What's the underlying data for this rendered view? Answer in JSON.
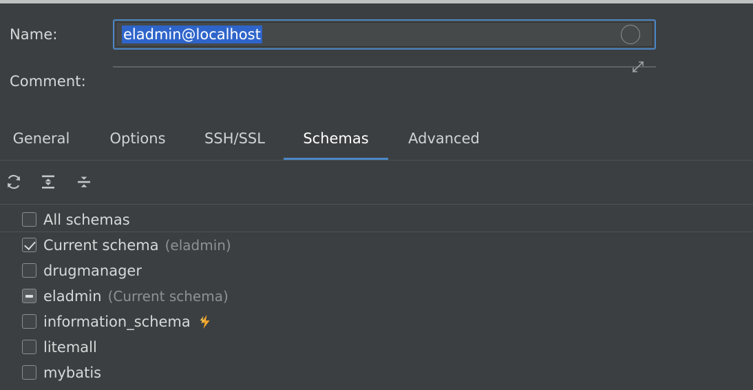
{
  "window": {
    "background_color": "#3c3f41",
    "accent_color": "#4b87c7"
  },
  "form": {
    "name": {
      "label": "Name:",
      "value": "eladmin@localhost",
      "placeholder": "",
      "selected": true,
      "focused": true,
      "trailing_icon": "color-circle-icon"
    },
    "comment": {
      "label": "Comment:",
      "value": "",
      "placeholder": "",
      "trailing_icon": "expand-icon"
    }
  },
  "tabs": {
    "active_index": 3,
    "items": [
      {
        "label": "General"
      },
      {
        "label": "Options"
      },
      {
        "label": "SSH/SSL"
      },
      {
        "label": "Schemas"
      },
      {
        "label": "Advanced"
      }
    ]
  },
  "toolbar": {
    "buttons": [
      {
        "icon": "refresh-icon",
        "tooltip": "Refresh"
      },
      {
        "icon": "expand-all-icon",
        "tooltip": "Expand All"
      },
      {
        "icon": "collapse-all-icon",
        "tooltip": "Collapse All"
      }
    ],
    "search": {
      "icon": "search-icon",
      "value": "",
      "placeholder": ""
    }
  },
  "schema_list": {
    "rows": [
      {
        "label": "All schemas",
        "note": "",
        "state": "unchecked",
        "badge": "",
        "separator_below": true
      },
      {
        "label": "Current schema",
        "note": "(eladmin)",
        "state": "checked",
        "badge": "",
        "separator_below": false
      },
      {
        "label": "drugmanager",
        "note": "",
        "state": "unchecked",
        "badge": "",
        "separator_below": false
      },
      {
        "label": "eladmin",
        "note": "(Current schema)",
        "state": "indeterminate",
        "badge": "",
        "separator_below": false
      },
      {
        "label": "information_schema",
        "note": "",
        "state": "unchecked",
        "badge": "lightning-bolt-icon",
        "separator_below": false
      },
      {
        "label": "litemall",
        "note": "",
        "state": "unchecked",
        "badge": "",
        "separator_below": false
      },
      {
        "label": "mybatis",
        "note": "",
        "state": "unchecked",
        "badge": "",
        "separator_below": false
      }
    ]
  }
}
